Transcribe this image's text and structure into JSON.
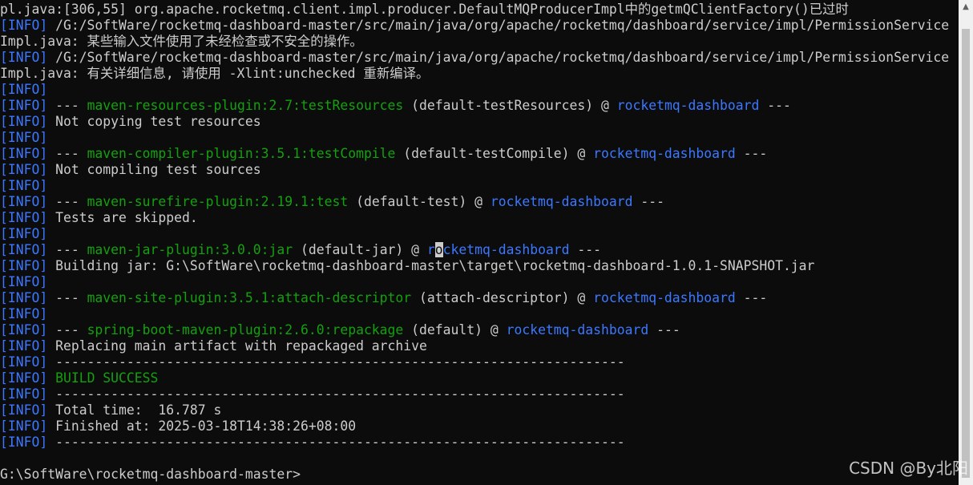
{
  "console": {
    "lines": [
      {
        "segments": [
          {
            "text": "pl.java:[306,55] org.apache.rocketmq.client.impl.producer.DefaultMQProducerImpl中的getmQClientFactory()已过时",
            "cls": ""
          }
        ]
      },
      {
        "segments": [
          {
            "text": "[INFO]",
            "cls": "tag"
          },
          {
            "text": " /G:/SoftWare/rocketmq-dashboard-master/src/main/java/org/apache/rocketmq/dashboard/service/impl/PermissionService",
            "cls": ""
          }
        ]
      },
      {
        "segments": [
          {
            "text": "Impl.java: 某些输入文件使用了未经检查或不安全的操作。",
            "cls": ""
          }
        ]
      },
      {
        "segments": [
          {
            "text": "[INFO]",
            "cls": "tag"
          },
          {
            "text": " /G:/SoftWare/rocketmq-dashboard-master/src/main/java/org/apache/rocketmq/dashboard/service/impl/PermissionService",
            "cls": ""
          }
        ]
      },
      {
        "segments": [
          {
            "text": "Impl.java: 有关详细信息, 请使用 -Xlint:unchecked 重新编译。",
            "cls": ""
          }
        ]
      },
      {
        "segments": [
          {
            "text": "[INFO]",
            "cls": "tag"
          }
        ]
      },
      {
        "segments": [
          {
            "text": "[INFO]",
            "cls": "tag"
          },
          {
            "text": " --- ",
            "cls": ""
          },
          {
            "text": "maven-resources-plugin:2.7:testResources",
            "cls": "plugin"
          },
          {
            "text": " (default-testResources) @ ",
            "cls": ""
          },
          {
            "text": "rocketmq-dashboard",
            "cls": "project"
          },
          {
            "text": " ---",
            "cls": ""
          }
        ]
      },
      {
        "segments": [
          {
            "text": "[INFO]",
            "cls": "tag"
          },
          {
            "text": " Not copying test resources",
            "cls": ""
          }
        ]
      },
      {
        "segments": [
          {
            "text": "[INFO]",
            "cls": "tag"
          }
        ]
      },
      {
        "segments": [
          {
            "text": "[INFO]",
            "cls": "tag"
          },
          {
            "text": " --- ",
            "cls": ""
          },
          {
            "text": "maven-compiler-plugin:3.5.1:testCompile",
            "cls": "plugin"
          },
          {
            "text": " (default-testCompile) @ ",
            "cls": ""
          },
          {
            "text": "rocketmq-dashboard",
            "cls": "project"
          },
          {
            "text": " ---",
            "cls": ""
          }
        ]
      },
      {
        "segments": [
          {
            "text": "[INFO]",
            "cls": "tag"
          },
          {
            "text": " Not compiling test sources",
            "cls": ""
          }
        ]
      },
      {
        "segments": [
          {
            "text": "[INFO]",
            "cls": "tag"
          }
        ]
      },
      {
        "segments": [
          {
            "text": "[INFO]",
            "cls": "tag"
          },
          {
            "text": " --- ",
            "cls": ""
          },
          {
            "text": "maven-surefire-plugin:2.19.1:test",
            "cls": "plugin"
          },
          {
            "text": " (default-test) @ ",
            "cls": ""
          },
          {
            "text": "rocketmq-dashboard",
            "cls": "project"
          },
          {
            "text": " ---",
            "cls": ""
          }
        ]
      },
      {
        "segments": [
          {
            "text": "[INFO]",
            "cls": "tag"
          },
          {
            "text": " Tests are skipped.",
            "cls": ""
          }
        ]
      },
      {
        "segments": [
          {
            "text": "[INFO]",
            "cls": "tag"
          }
        ]
      },
      {
        "segments": [
          {
            "text": "[INFO]",
            "cls": "tag"
          },
          {
            "text": " --- ",
            "cls": ""
          },
          {
            "text": "maven-jar-plugin:3.0.0:jar",
            "cls": "plugin"
          },
          {
            "text": " (default-jar) @ ",
            "cls": ""
          },
          {
            "text": "r",
            "cls": "project"
          },
          {
            "text": "o",
            "cls": "cursor"
          },
          {
            "text": "cketmq-dashboard",
            "cls": "project"
          },
          {
            "text": " ---",
            "cls": ""
          }
        ]
      },
      {
        "segments": [
          {
            "text": "[INFO]",
            "cls": "tag"
          },
          {
            "text": " Building jar: G:\\SoftWare\\rocketmq-dashboard-master\\target\\rocketmq-dashboard-1.0.1-SNAPSHOT.jar",
            "cls": ""
          }
        ]
      },
      {
        "segments": [
          {
            "text": "[INFO]",
            "cls": "tag"
          }
        ]
      },
      {
        "segments": [
          {
            "text": "[INFO]",
            "cls": "tag"
          },
          {
            "text": " --- ",
            "cls": ""
          },
          {
            "text": "maven-site-plugin:3.5.1:attach-descriptor",
            "cls": "plugin"
          },
          {
            "text": " (attach-descriptor) @ ",
            "cls": ""
          },
          {
            "text": "rocketmq-dashboard",
            "cls": "project"
          },
          {
            "text": " ---",
            "cls": ""
          }
        ]
      },
      {
        "segments": [
          {
            "text": "[INFO]",
            "cls": "tag"
          }
        ]
      },
      {
        "segments": [
          {
            "text": "[INFO]",
            "cls": "tag"
          },
          {
            "text": " --- ",
            "cls": ""
          },
          {
            "text": "spring-boot-maven-plugin:2.6.0:repackage",
            "cls": "plugin"
          },
          {
            "text": " (default) @ ",
            "cls": ""
          },
          {
            "text": "rocketmq-dashboard",
            "cls": "project"
          },
          {
            "text": " ---",
            "cls": ""
          }
        ]
      },
      {
        "segments": [
          {
            "text": "[INFO]",
            "cls": "tag"
          },
          {
            "text": " Replacing main artifact with repackaged archive",
            "cls": ""
          }
        ]
      },
      {
        "segments": [
          {
            "text": "[INFO]",
            "cls": "tag"
          },
          {
            "text": " ------------------------------------------------------------------------",
            "cls": ""
          }
        ]
      },
      {
        "segments": [
          {
            "text": "[INFO]",
            "cls": "tag"
          },
          {
            "text": " ",
            "cls": ""
          },
          {
            "text": "BUILD SUCCESS",
            "cls": "success"
          }
        ]
      },
      {
        "segments": [
          {
            "text": "[INFO]",
            "cls": "tag"
          },
          {
            "text": " ------------------------------------------------------------------------",
            "cls": ""
          }
        ]
      },
      {
        "segments": [
          {
            "text": "[INFO]",
            "cls": "tag"
          },
          {
            "text": " Total time:  16.787 s",
            "cls": ""
          }
        ]
      },
      {
        "segments": [
          {
            "text": "[INFO]",
            "cls": "tag"
          },
          {
            "text": " Finished at: 2025-03-18T14:38:26+08:00",
            "cls": ""
          }
        ]
      },
      {
        "segments": [
          {
            "text": "[INFO]",
            "cls": "tag"
          },
          {
            "text": " ------------------------------------------------------------------------",
            "cls": ""
          }
        ]
      },
      {
        "segments": [
          {
            "text": "",
            "cls": ""
          }
        ]
      },
      {
        "segments": [
          {
            "text": "G:\\SoftWare\\rocketmq-dashboard-master>",
            "cls": ""
          }
        ]
      }
    ]
  },
  "scrollbar": {
    "up_icon": "chevron-up-icon"
  },
  "watermark": "CSDN @By北阳",
  "colors": {
    "background": "#0c0c0c",
    "text": "#cccccc",
    "info_tag": "#3b78ff",
    "plugin": "#13a10e",
    "project": "#3b78ff",
    "success": "#13a10e"
  }
}
